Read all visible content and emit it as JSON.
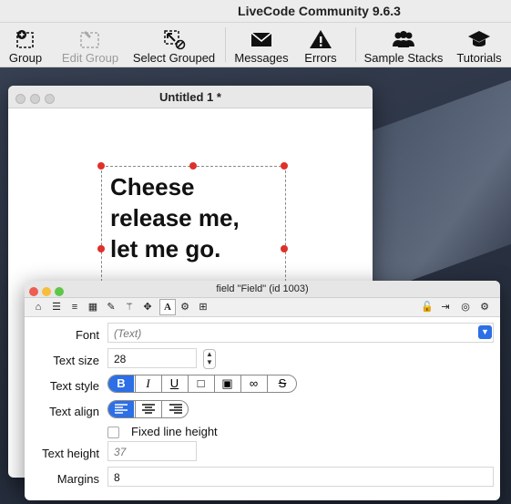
{
  "app": {
    "title": "LiveCode Community 9.6.3"
  },
  "toolbar": {
    "group": "Group",
    "edit_group": "Edit Group",
    "select_grouped": "Select Grouped",
    "messages": "Messages",
    "errors": "Errors",
    "sample_stacks": "Sample Stacks",
    "tutorials": "Tutorials"
  },
  "stack": {
    "title": "Untitled 1 *",
    "field_lines": [
      "Cheese",
      "release me,",
      "let me go."
    ]
  },
  "inspector": {
    "title": "field \"Field\" (id 1003)",
    "font": {
      "label": "Font",
      "value": "(Text)"
    },
    "text_size": {
      "label": "Text size",
      "value": "28"
    },
    "text_style": {
      "label": "Text style",
      "options": [
        "B",
        "I",
        "U",
        "□",
        "▣",
        "∞",
        "S"
      ],
      "selected": "B"
    },
    "text_align": {
      "label": "Text align",
      "options": [
        "left",
        "center",
        "right"
      ],
      "selected": "left"
    },
    "fixed_line_height": {
      "label": "Fixed line height",
      "checked": false
    },
    "text_height": {
      "label": "Text height",
      "placeholder": "37"
    },
    "margins": {
      "label": "Margins",
      "value": "8"
    }
  },
  "colors": {
    "accent": "#2c6fe6",
    "handle": "#e0302a"
  }
}
